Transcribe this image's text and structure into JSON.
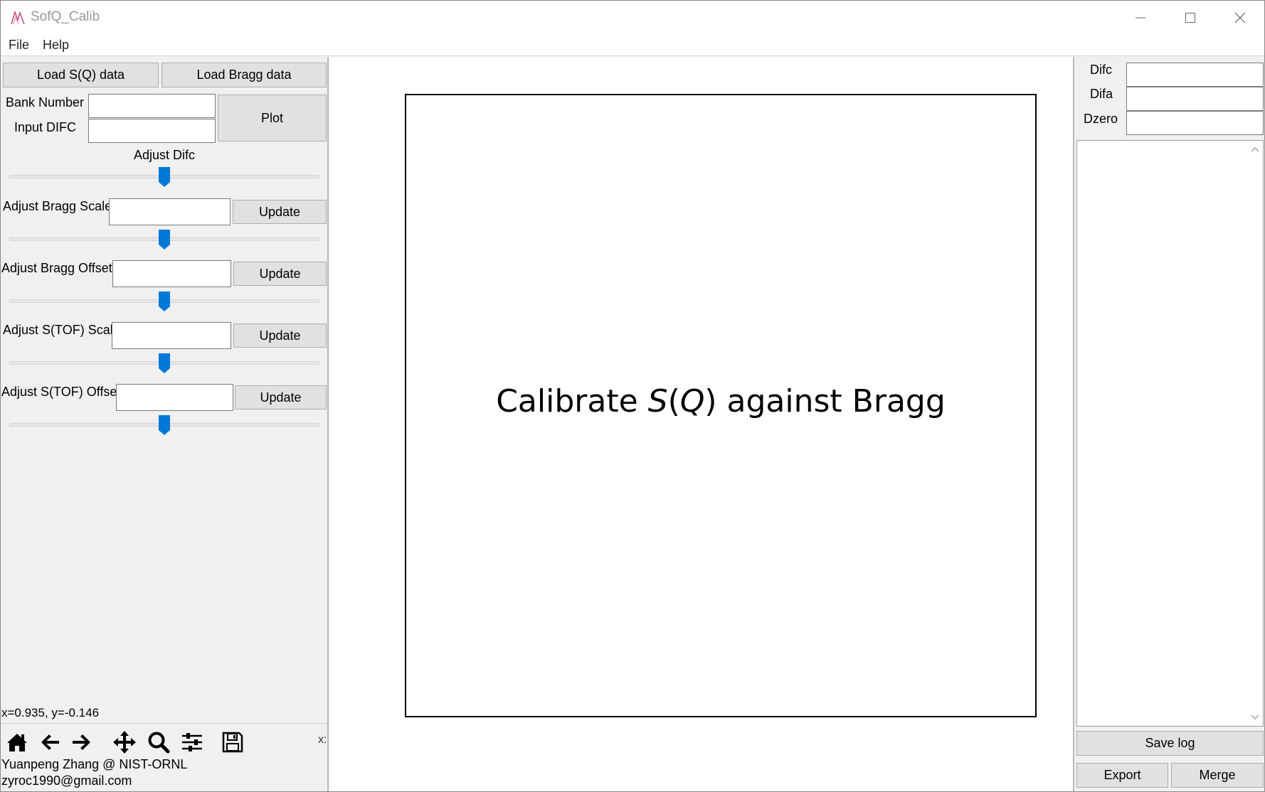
{
  "window": {
    "title": "SofQ_Calib",
    "controls": [
      "minimize-icon",
      "maximize-icon",
      "close-icon"
    ]
  },
  "menubar": {
    "items": [
      "File",
      "Help"
    ]
  },
  "left_panel": {
    "load_sq_label": "Load S(Q) data",
    "load_bragg_label": "Load Bragg data",
    "bank_number_label": "Bank Number",
    "bank_number_value": "",
    "input_difc_label": "Input DIFC",
    "input_difc_value": "",
    "plot_label": "Plot",
    "adjust_difc_label": "Adjust Difc",
    "controls": [
      {
        "label": "Adjust Bragg Scale",
        "value": "",
        "button": "Update"
      },
      {
        "label": "Adjust Bragg Offset",
        "value": "",
        "button": "Update"
      },
      {
        "label": "Adjust S(TOF) Scale",
        "value": "",
        "button": "Update"
      },
      {
        "label": "Adjust S(TOF) Offset",
        "value": "",
        "button": "Update"
      }
    ],
    "sliders": [
      {
        "name": "difc",
        "position": 0.5
      },
      {
        "name": "bragg-scale",
        "position": 0.5
      },
      {
        "name": "bragg-offset",
        "position": 0.5
      },
      {
        "name": "stof-scale",
        "position": 0.5
      },
      {
        "name": "stof-offset",
        "position": 0.5
      }
    ],
    "coord_readout": "x=0.935, y=-0.146",
    "toolbar_x": "x:",
    "toolbar_icons": [
      "home-icon",
      "back-icon",
      "forward-icon",
      "pan-icon",
      "zoom-icon",
      "configure-subplots-icon",
      "save-figure-icon"
    ],
    "credit_line1": "Yuanpeng Zhang @ NIST-ORNL",
    "credit_line2": "zyroc1990@gmail.com"
  },
  "plot": {
    "title_pre": "Calibrate ",
    "title_s": "S",
    "title_paren_open": "(",
    "title_q": "Q",
    "title_post": ") against Bragg"
  },
  "right_panel": {
    "fields": [
      {
        "label": "Difc",
        "value": ""
      },
      {
        "label": "Difa",
        "value": ""
      },
      {
        "label": "Dzero",
        "value": ""
      }
    ],
    "log_text": "",
    "save_log_label": "Save log",
    "export_label": "Export",
    "merge_label": "Merge"
  },
  "colors": {
    "slider_handle": "#0078d7",
    "app_icon": "#c0487a"
  }
}
